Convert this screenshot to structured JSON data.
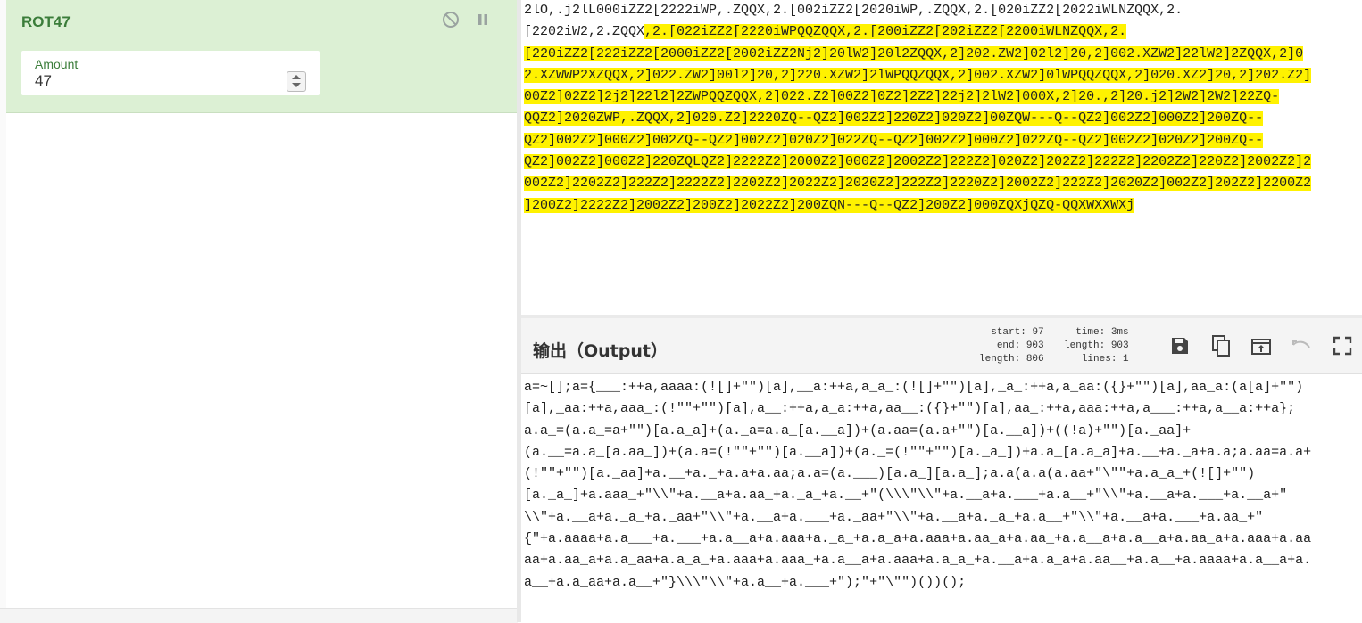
{
  "recipe": {
    "operation_title": "ROT47",
    "disable_icon": "disable-icon",
    "pause_icon": "pause-icon",
    "amount_label": "Amount",
    "amount_value": "47"
  },
  "input": {
    "lines": [
      {
        "plain": "2lO,.j2lL000iZZ2[2222iWP,.ZQQX,2.[002iZZ2[2020iWP,.ZQQX,2.[020iZZ2[2022iWLNZQQX,2.",
        "highlight": ""
      },
      {
        "plain": "[2202iW2,2.ZQQX",
        "highlight": ",2.[022iZZ2[2220iWPQQZQQX,2.[200iZZ2[202iZZ2[2200iWLNZQQX,2."
      },
      {
        "plain": "",
        "highlight": "[220iZZ2[222iZZ2[2000iZZ2[2002iZZ2Nj2]20lW2]20l2ZQQX,2]202.ZW2]02l2]20,2]002.XZW2]22lW2]2ZQQX,2]0"
      },
      {
        "plain": "",
        "highlight": "2.XZWWP2XZQQX,2]022.ZW2]00l2]20,2]220.XZW2]2lWPQQZQQX,2]002.XZW2]0lWPQQZQQX,2]020.XZ2]20,2]202.Z2]"
      },
      {
        "plain": "",
        "highlight": "00Z2]02Z2]2j2]22l2]2ZWPQQZQQX,2]022.Z2]00Z2]0Z2]2Z2]22j2]2lW2]000X,2]20.,2]20.j2]2W2]2W2]22ZQ-"
      },
      {
        "plain": "",
        "highlight": "QQZ2]2020ZWP,.ZQQX,2]020.Z2]2220ZQ--QZ2]002Z2]220Z2]020Z2]00ZQW---Q--QZ2]002Z2]000Z2]200ZQ--"
      },
      {
        "plain": "",
        "highlight": "QZ2]002Z2]000Z2]002ZQ--QZ2]002Z2]020Z2]022ZQ--QZ2]002Z2]000Z2]022ZQ--QZ2]002Z2]020Z2]200ZQ--"
      },
      {
        "plain": "",
        "highlight": "QZ2]002Z2]000Z2]220ZQLQZ2]2222Z2]2000Z2]000Z2]2002Z2]222Z2]020Z2]202Z2]222Z2]2202Z2]220Z2]2002Z2]2"
      },
      {
        "plain": "",
        "highlight": "002Z2]2202Z2]222Z2]2222Z2]2202Z2]2022Z2]2020Z2]222Z2]2220Z2]2002Z2]222Z2]2020Z2]002Z2]202Z2]2200Z2"
      },
      {
        "plain": "",
        "highlight": "]200Z2]2222Z2]2002Z2]200Z2]2022Z2]200ZQN---Q--QZ2]200Z2]000ZQXjQZQ-QQXWXXWXj"
      }
    ]
  },
  "output": {
    "title": "输出（Output）",
    "stats": {
      "start_label": "start:",
      "start": "97",
      "end_label": "end:",
      "end": "903",
      "length_label": "length:",
      "length_sel": "806",
      "time_label": "time:",
      "time": "3ms",
      "length2_label": "length:",
      "length": "903",
      "lines_label": "lines:",
      "lines": "1"
    },
    "toolbar": {
      "save_icon": "save-icon",
      "copy_icon": "copy-icon",
      "replace_input_icon": "replace-input-icon",
      "undo_icon": "undo-icon",
      "maximise_icon": "maximise-icon"
    },
    "lines": [
      "a=~[];a={___:++a,aaaa:(![]+\"\")[a],__a:++a,a_a_:(![]+\"\")[a],_a_:++a,a_aa:({}+\"\")[a],aa_a:(a[a]+\"\")",
      "[a],_aa:++a,aaa_:(!\"\"+\"\")[a],a__:++a,a_a:++a,aa__:({}+\"\")[a],aa_:++a,aaa:++a,a___:++a,a__a:++a};",
      "a.a_=(a.a_=a+\"\")[a.a_a]+(a._a=a.a_[a.__a])+(a.aa=(a.a+\"\")[a.__a])+((!a)+\"\")[a._aa]+",
      "(a.__=a.a_[a.aa_])+(a.a=(!\"\"+\"\")[a.__a])+(a._=(!\"\"+\"\")[a._a_])+a.a_[a.a_a]+a.__+a._a+a.a;a.aa=a.a+",
      "(!\"\"+\"\")[a._aa]+a.__+a._+a.a+a.aa;a.a=(a.___)[a.a_][a.a_];a.a(a.a(a.aa+\"\\\"\"+a.a_a_+(![]+\"\")",
      "[a._a_]+a.aaa_+\"\\\\\"+a.__a+a.aa_+a._a_+a.__+\"(\\\\\\\"\\\\\"+a.__a+a.___+a.a__+\"\\\\\"+a.__a+a.___+a.__a+\"",
      "\\\\\"+a.__a+a._a_+a._aa+\"\\\\\"+a.__a+a.___+a._aa+\"\\\\\"+a.__a+a._a_+a.a__+\"\\\\\"+a.__a+a.___+a.aa_+\"",
      "{\"+a.aaaa+a.a___+a.___+a.a__a+a.aaa+a._a_+a.a_a+a.aaa+a.aa_a+a.aa_+a.a__a+a.a__a+a.aa_a+a.aaa+a.aa",
      "aa+a.aa_a+a.a_aa+a.a_a_+a.aaa+a.aaa_+a.a__a+a.aaa+a.a_a_+a.__a+a.a_a+a.aa__+a.a__+a.aaaa+a.a__a+a.",
      "a__+a.a_aa+a.a__+\"}\\\\\\\"\\\\\"+a.a__+a.___+\");\"+\"\\\"\")())();"
    ]
  },
  "colors": {
    "operation_bg": "#dcf0d4",
    "operation_text": "#3b7d3a",
    "highlight": "#fff200"
  }
}
